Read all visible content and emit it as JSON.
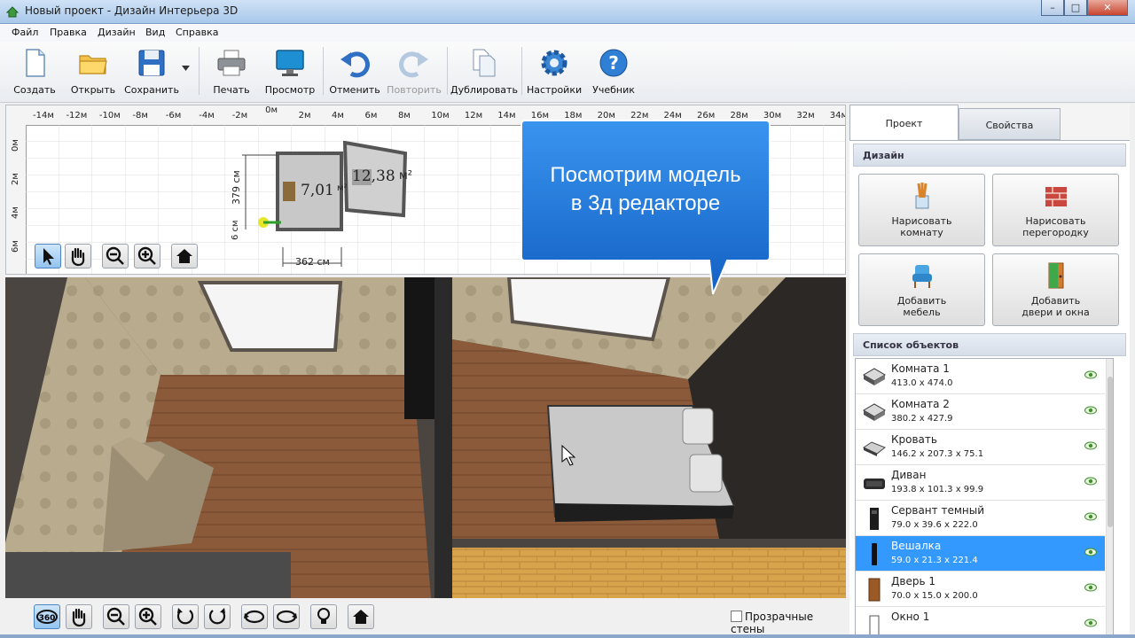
{
  "window": {
    "title": "Новый проект - Дизайн Интерьера 3D",
    "controls": {
      "minimize": "–",
      "maximize": "□",
      "close": "✕"
    }
  },
  "menu": {
    "items": [
      "Файл",
      "Правка",
      "Дизайн",
      "Вид",
      "Справка"
    ]
  },
  "toolbar": {
    "create": "Создать",
    "open": "Открыть",
    "save": "Сохранить",
    "print": "Печать",
    "preview": "Просмотр",
    "undo": "Отменить",
    "redo": "Повторить",
    "duplicate": "Дублировать",
    "settings": "Настройки",
    "tutorial": "Учебник"
  },
  "plan": {
    "ruler_top": [
      "-14м",
      "-12м",
      "-10м",
      "-8м",
      "-6м",
      "-4м",
      "-2м",
      "0м",
      "2м",
      "4м",
      "6м",
      "8м",
      "10м",
      "12м",
      "14м",
      "16м",
      "18м",
      "20м",
      "22м",
      "24м",
      "26м",
      "28м",
      "30м",
      "32м",
      "34м"
    ],
    "ruler_left": [
      "0м",
      "2м",
      "4м",
      "6м"
    ],
    "room1_area": "7,01",
    "room1_unit": "м²",
    "room2_area": "12,38",
    "room2_unit": "м²",
    "dim_height": "379 см",
    "dim_small": "6 см",
    "dim_width": "362 см"
  },
  "callout": {
    "line1": "Посмотрим модель",
    "line2": "в 3д редакторе"
  },
  "bottom": {
    "transparent_walls": "Прозрачные стены",
    "transparent_walls_checked": false
  },
  "panel": {
    "tabs": {
      "project": "Проект",
      "properties": "Свойства"
    },
    "design_header": "Дизайн",
    "buttons": {
      "draw_room": [
        "Нарисовать",
        "комнату"
      ],
      "draw_partition": [
        "Нарисовать",
        "перегородку"
      ],
      "add_furniture": [
        "Добавить",
        "мебель"
      ],
      "add_doors": [
        "Добавить",
        "двери и окна"
      ]
    },
    "objects_header": "Список объектов",
    "objects": [
      {
        "name": "Комната 1",
        "dims": "413.0 x 474.0",
        "icon": "room-icon",
        "selected": false
      },
      {
        "name": "Комната 2",
        "dims": "380.2 x 427.9",
        "icon": "room-icon",
        "selected": false
      },
      {
        "name": "Кровать",
        "dims": "146.2 x 207.3 x 75.1",
        "icon": "bed-icon",
        "selected": false
      },
      {
        "name": "Диван",
        "dims": "193.8 x 101.3 x 99.9",
        "icon": "sofa-icon",
        "selected": false
      },
      {
        "name": "Сервант темный",
        "dims": "79.0 x 39.6 x 222.0",
        "icon": "cabinet-icon",
        "selected": false
      },
      {
        "name": "Вешалка",
        "dims": "59.0 x 21.3 x 221.4",
        "icon": "hanger-icon",
        "selected": true
      },
      {
        "name": "Дверь 1",
        "dims": "70.0 x 15.0 x 200.0",
        "icon": "door-icon",
        "selected": false
      },
      {
        "name": "Окно 1",
        "dims": "",
        "icon": "window-icon",
        "selected": false
      }
    ]
  },
  "colors": {
    "selection": "#3399ff",
    "callout": "#1f72d9",
    "accent": "#2f6fc4"
  }
}
